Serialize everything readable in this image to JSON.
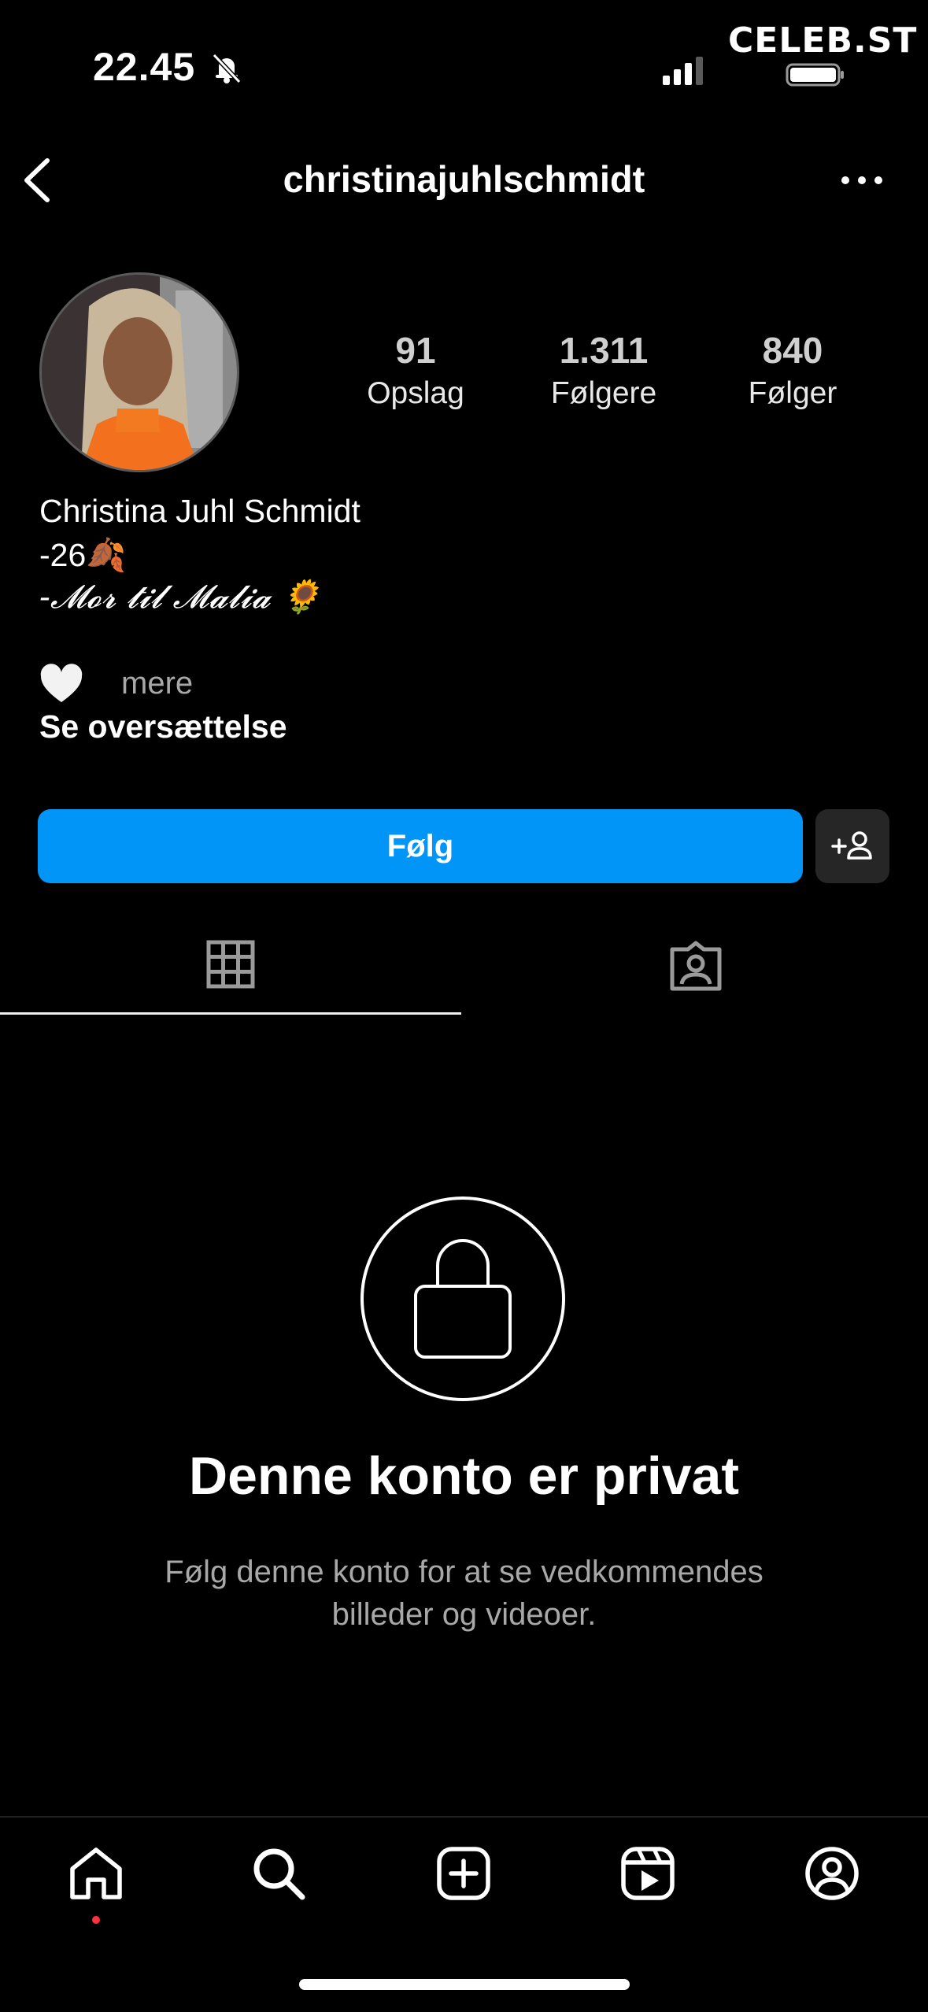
{
  "status_bar": {
    "time": "22.45",
    "watermark": "CELEB.ST"
  },
  "header": {
    "username": "christinajuhlschmidt"
  },
  "profile": {
    "stats": [
      {
        "value": "91",
        "label": "Opslag"
      },
      {
        "value": "1.311",
        "label": "Følgere"
      },
      {
        "value": "840",
        "label": "Følger"
      }
    ],
    "full_name": "Christina Juhl Schmidt",
    "bio_line1": "-26🍂",
    "bio_line2": "-𝓜𝓸𝓻 𝓽𝓲𝓵 𝓜𝓪𝓵𝓲𝓪 🌻",
    "more_label": "mere",
    "translate_label": "Se oversættelse"
  },
  "actions": {
    "follow_label": "Følg"
  },
  "private": {
    "title": "Denne konto er privat",
    "subtitle_line1": "Følg denne konto for at se vedkommendes",
    "subtitle_line2": "billeder og videoer."
  },
  "colors": {
    "background": "#000000",
    "follow_button": "#0095f6",
    "secondary_button": "#262626",
    "notification_dot": "#ff3040"
  },
  "icons": [
    "bell-slash-icon",
    "signal-icon",
    "battery-icon",
    "back-arrow-icon",
    "more-options-icon",
    "heart-icon",
    "add-person-icon",
    "grid-icon",
    "tagged-icon",
    "lock-icon",
    "home-icon",
    "search-icon",
    "create-icon",
    "reels-icon",
    "profile-icon"
  ]
}
